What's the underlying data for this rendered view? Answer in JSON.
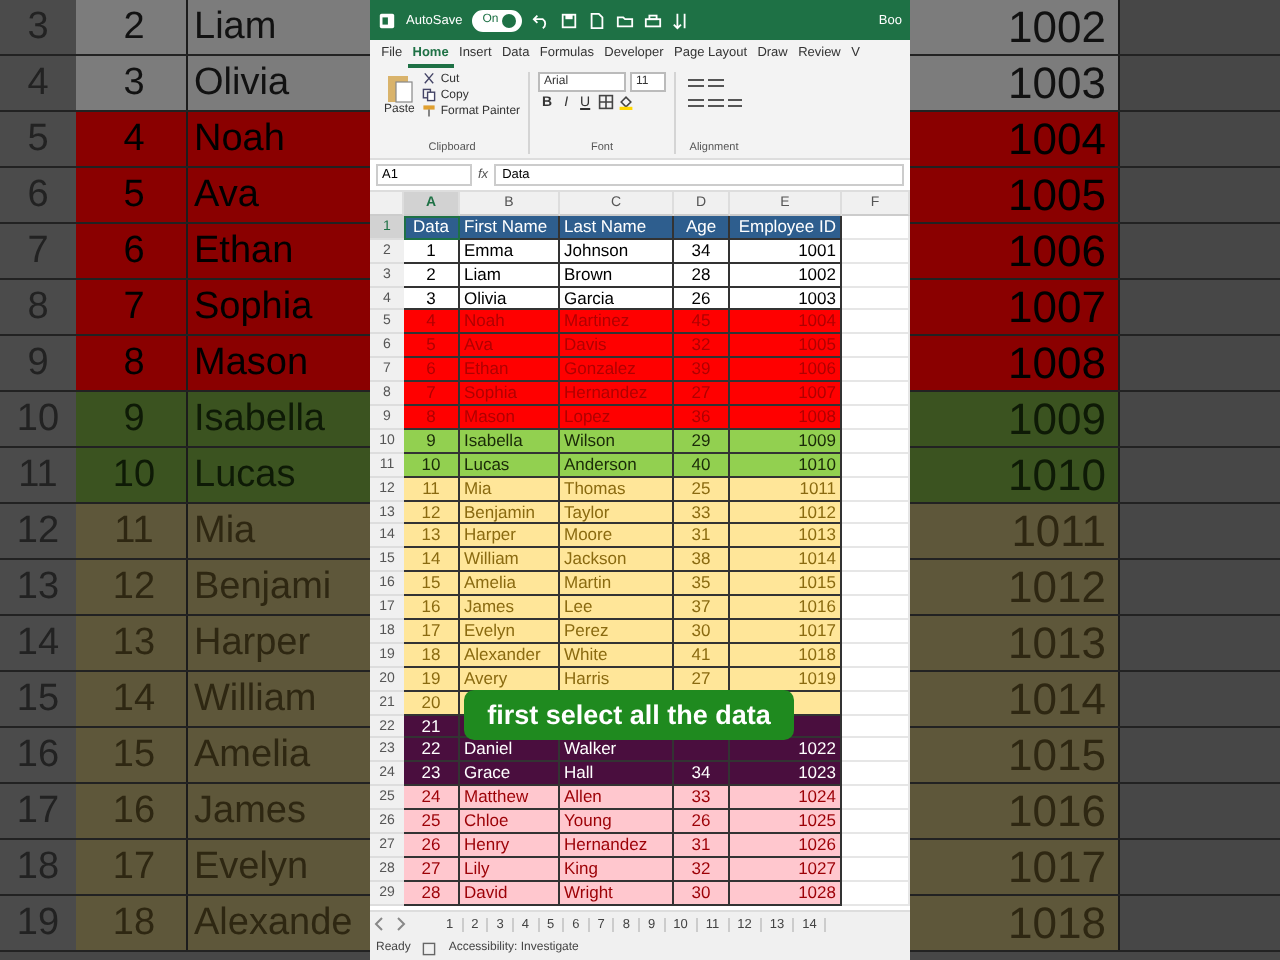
{
  "backdrop": {
    "rows": [
      {
        "row": "3",
        "num": "2",
        "first": "Liam",
        "id": "1002",
        "kind": "plain"
      },
      {
        "row": "4",
        "num": "3",
        "first": "Olivia",
        "id": "1003",
        "kind": "plain"
      },
      {
        "row": "5",
        "num": "4",
        "first": "Noah",
        "id": "1004",
        "kind": "red"
      },
      {
        "row": "6",
        "num": "5",
        "first": "Ava",
        "id": "1005",
        "kind": "red"
      },
      {
        "row": "7",
        "num": "6",
        "first": "Ethan",
        "id": "1006",
        "kind": "red"
      },
      {
        "row": "8",
        "num": "7",
        "first": "Sophia",
        "id": "1007",
        "kind": "red"
      },
      {
        "row": "9",
        "num": "8",
        "first": "Mason",
        "id": "1008",
        "kind": "red"
      },
      {
        "row": "10",
        "num": "9",
        "first": "Isabella",
        "id": "1009",
        "kind": "green"
      },
      {
        "row": "11",
        "num": "10",
        "first": "Lucas",
        "id": "1010",
        "kind": "green"
      },
      {
        "row": "12",
        "num": "11",
        "first": "Mia",
        "id": "1011",
        "kind": "yellow"
      },
      {
        "row": "13",
        "num": "12",
        "first": "Benjami",
        "id": "1012",
        "kind": "yellow"
      },
      {
        "row": "14",
        "num": "13",
        "first": "Harper",
        "id": "1013",
        "kind": "yellow"
      },
      {
        "row": "15",
        "num": "14",
        "first": "William",
        "id": "1014",
        "kind": "yellow"
      },
      {
        "row": "16",
        "num": "15",
        "first": "Amelia",
        "id": "1015",
        "kind": "yellow"
      },
      {
        "row": "17",
        "num": "16",
        "first": "James",
        "id": "1016",
        "kind": "yellow"
      },
      {
        "row": "18",
        "num": "17",
        "first": "Evelyn",
        "id": "1017",
        "kind": "yellow"
      },
      {
        "row": "19",
        "num": "18",
        "first": "Alexande",
        "id": "1018",
        "kind": "yellow"
      }
    ]
  },
  "title_bar": {
    "autosave_label": "AutoSave",
    "autosave": {
      "on": true,
      "label": "On"
    },
    "doc_title": "Boo"
  },
  "tabs": [
    {
      "label": "File",
      "selected": false
    },
    {
      "label": "Home",
      "selected": true
    },
    {
      "label": "Insert",
      "selected": false
    },
    {
      "label": "Data",
      "selected": false
    },
    {
      "label": "Formulas",
      "selected": false
    },
    {
      "label": "Developer",
      "selected": false
    },
    {
      "label": "Page Layout",
      "selected": false
    },
    {
      "label": "Draw",
      "selected": false
    },
    {
      "label": "Review",
      "selected": false
    },
    {
      "label": "V",
      "selected": false
    }
  ],
  "ribbon": {
    "clipboard": {
      "paste": "Paste",
      "cut": "Cut",
      "copy": "Copy",
      "format_painter": "Format Painter",
      "group": "Clipboard"
    },
    "font": {
      "family": "Arial",
      "size": "11",
      "styles": [
        "B",
        "I",
        "U"
      ],
      "group": "Font"
    },
    "alignment": {
      "group": "Alignment"
    }
  },
  "formula_bar": {
    "name_box": "A1",
    "fx": "fx",
    "value": "Data"
  },
  "columns": [
    {
      "label": "A",
      "selected": true
    },
    {
      "label": "B",
      "selected": false
    },
    {
      "label": "C",
      "selected": false
    },
    {
      "label": "D",
      "selected": false
    },
    {
      "label": "E",
      "selected": false
    },
    {
      "label": "F",
      "selected": false
    }
  ],
  "rows": [
    {
      "row": "1",
      "kind": "header",
      "selected": true,
      "cells": [
        "Data",
        "First Name",
        "Last Name",
        "Age",
        "Employee ID"
      ]
    },
    {
      "row": "2",
      "kind": "plain",
      "selected": false,
      "cells": [
        "1",
        "Emma",
        "Johnson",
        "34",
        "1001"
      ]
    },
    {
      "row": "3",
      "kind": "plain",
      "selected": false,
      "cells": [
        "2",
        "Liam",
        "Brown",
        "28",
        "1002"
      ]
    },
    {
      "row": "4",
      "kind": "plain",
      "selected": false,
      "cells": [
        "3",
        "Olivia",
        "Garcia",
        "26",
        "1003"
      ]
    },
    {
      "row": "5",
      "kind": "red",
      "selected": false,
      "cells": [
        "4",
        "Noah",
        "Martinez",
        "45",
        "1004"
      ]
    },
    {
      "row": "6",
      "kind": "red",
      "selected": false,
      "cells": [
        "5",
        "Ava",
        "Davis",
        "32",
        "1005"
      ]
    },
    {
      "row": "7",
      "kind": "red",
      "selected": false,
      "cells": [
        "6",
        "Ethan",
        "Gonzalez",
        "39",
        "1006"
      ]
    },
    {
      "row": "8",
      "kind": "red",
      "selected": false,
      "cells": [
        "7",
        "Sophia",
        "Hernandez",
        "27",
        "1007"
      ]
    },
    {
      "row": "9",
      "kind": "red",
      "selected": false,
      "cells": [
        "8",
        "Mason",
        "Lopez",
        "36",
        "1008"
      ]
    },
    {
      "row": "10",
      "kind": "green",
      "selected": false,
      "cells": [
        "9",
        "Isabella",
        "Wilson",
        "29",
        "1009"
      ]
    },
    {
      "row": "11",
      "kind": "green",
      "selected": false,
      "cells": [
        "10",
        "Lucas",
        "Anderson",
        "40",
        "1010"
      ]
    },
    {
      "row": "12",
      "kind": "yellow",
      "selected": false,
      "cells": [
        "11",
        "Mia",
        "Thomas",
        "25",
        "1011"
      ]
    },
    {
      "row": "13",
      "kind": "yellow",
      "selected": false,
      "cells": [
        "12",
        "Benjamin",
        "Taylor",
        "33",
        "1012"
      ]
    },
    {
      "row": "14",
      "kind": "yellow",
      "selected": false,
      "cells": [
        "13",
        "Harper",
        "Moore",
        "31",
        "1013"
      ]
    },
    {
      "row": "15",
      "kind": "yellow",
      "selected": false,
      "cells": [
        "14",
        "William",
        "Jackson",
        "38",
        "1014"
      ]
    },
    {
      "row": "16",
      "kind": "yellow",
      "selected": false,
      "cells": [
        "15",
        "Amelia",
        "Martin",
        "35",
        "1015"
      ]
    },
    {
      "row": "17",
      "kind": "yellow",
      "selected": false,
      "cells": [
        "16",
        "James",
        "Lee",
        "37",
        "1016"
      ]
    },
    {
      "row": "18",
      "kind": "yellow",
      "selected": false,
      "cells": [
        "17",
        "Evelyn",
        "Perez",
        "30",
        "1017"
      ]
    },
    {
      "row": "19",
      "kind": "yellow",
      "selected": false,
      "cells": [
        "18",
        "Alexander",
        "White",
        "41",
        "1018"
      ]
    },
    {
      "row": "20",
      "kind": "yellow",
      "selected": false,
      "cells": [
        "19",
        "Avery",
        "Harris",
        "27",
        "1019"
      ]
    },
    {
      "row": "21",
      "kind": "yellow",
      "selected": false,
      "cells": [
        "20"
      ]
    },
    {
      "row": "22",
      "kind": "purple",
      "selected": false,
      "cells": [
        "21"
      ]
    },
    {
      "row": "23",
      "kind": "purple",
      "selected": false,
      "cells": [
        "22",
        "Daniel",
        "Walker",
        "",
        "1022"
      ]
    },
    {
      "row": "24",
      "kind": "purple",
      "selected": false,
      "cells": [
        "23",
        "Grace",
        "Hall",
        "34",
        "1023"
      ]
    },
    {
      "row": "25",
      "kind": "pink",
      "selected": false,
      "cells": [
        "24",
        "Matthew",
        "Allen",
        "33",
        "1024"
      ]
    },
    {
      "row": "26",
      "kind": "pink",
      "selected": false,
      "cells": [
        "25",
        "Chloe",
        "Young",
        "26",
        "1025"
      ]
    },
    {
      "row": "27",
      "kind": "pink",
      "selected": false,
      "cells": [
        "26",
        "Henry",
        "Hernandez",
        "31",
        "1026"
      ]
    },
    {
      "row": "28",
      "kind": "pink",
      "selected": false,
      "cells": [
        "27",
        "Lily",
        "King",
        "32",
        "1027"
      ]
    },
    {
      "row": "29",
      "kind": "pink",
      "selected": false,
      "cells": [
        "28",
        "David",
        "Wright",
        "30",
        "1028"
      ]
    }
  ],
  "caption": {
    "text": "first select all the data"
  },
  "sheet_tabs": [
    "1",
    "2",
    "3",
    "4",
    "5",
    "6",
    "7",
    "8",
    "9",
    "10",
    "11",
    "12",
    "13",
    "14"
  ],
  "status_bar": {
    "mode": "Ready",
    "accessibility": "Accessibility: Investigate"
  }
}
